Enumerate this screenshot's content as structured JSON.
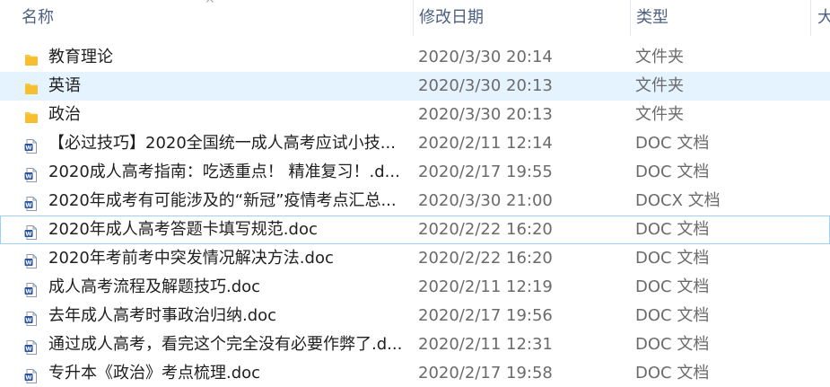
{
  "columns": {
    "name": "名称",
    "date": "修改日期",
    "type": "类型",
    "size": "大"
  },
  "sort_indicator": "^",
  "colors": {
    "folder": "#f8c843",
    "hover_bg": "#e5f3ff",
    "focus_border": "#9bd1f7",
    "header_text": "#4d6082",
    "secondary_text": "#6b6b6b",
    "doc_icon": "#2b579a"
  },
  "files": [
    {
      "icon": "folder-icon",
      "name": "教育理论",
      "date": "2020/3/30 20:14",
      "type": "文件夹"
    },
    {
      "icon": "folder-icon",
      "name": "英语",
      "date": "2020/3/30 20:13",
      "type": "文件夹",
      "hovered": true
    },
    {
      "icon": "folder-icon",
      "name": "政治",
      "date": "2020/3/30 20:13",
      "type": "文件夹"
    },
    {
      "icon": "word-doc-icon",
      "name": "【必过技巧】2020全国统一成人高考应试小技...",
      "date": "2020/2/11 12:14",
      "type": "DOC 文档"
    },
    {
      "icon": "word-doc-icon",
      "name": "2020成人高考指南：吃透重点！ 精准复习！.d...",
      "date": "2020/2/17 19:55",
      "type": "DOC 文档"
    },
    {
      "icon": "word-docx-icon",
      "name": "2020年成考有可能涉及的“新冠”疫情考点汇总...",
      "date": "2020/3/30 21:00",
      "type": "DOCX 文档"
    },
    {
      "icon": "word-doc-icon",
      "name": "2020年成人高考答题卡填写规范.doc",
      "date": "2020/2/22 16:20",
      "type": "DOC 文档",
      "focused": true
    },
    {
      "icon": "word-doc-icon",
      "name": "2020年考前考中突发情况解决方法.doc",
      "date": "2020/2/22 16:20",
      "type": "DOC 文档"
    },
    {
      "icon": "word-doc-icon",
      "name": "成人高考流程及解题技巧.doc",
      "date": "2020/2/11 12:19",
      "type": "DOC 文档"
    },
    {
      "icon": "word-doc-icon",
      "name": "去年成人高考时事政治归纳.doc",
      "date": "2020/2/17 19:56",
      "type": "DOC 文档"
    },
    {
      "icon": "word-doc-icon",
      "name": "通过成人高考，看完这个完全没有必要作弊了.d...",
      "date": "2020/2/11 12:31",
      "type": "DOC 文档"
    },
    {
      "icon": "word-doc-icon",
      "name": "专升本《政治》考点梳理.doc",
      "date": "2020/2/17 19:58",
      "type": "DOC 文档"
    }
  ]
}
